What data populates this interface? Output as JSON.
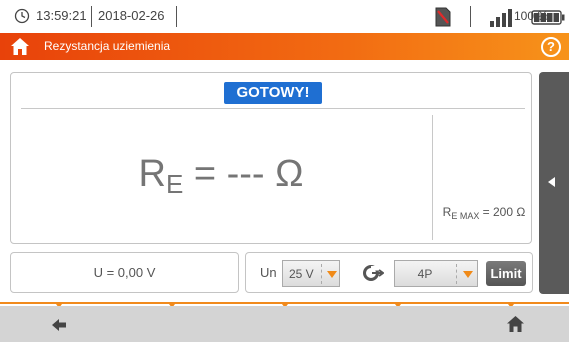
{
  "status_bar": {
    "time": "13:59:21",
    "date": "2018-02-26",
    "battery_percent": "100 %",
    "icons": [
      "clock-icon",
      "sd-card-icon",
      "signal-strength-icon",
      "battery-icon"
    ]
  },
  "title_bar": {
    "title": "Rezystancja uziemienia",
    "home_icon": "home-icon",
    "help_label": "?"
  },
  "measurement": {
    "status_badge": "GOTOWY!",
    "reading_symbol": "R",
    "reading_subscript": "E",
    "reading_value": " = --- Ω",
    "limit_symbol": "R",
    "limit_subscript": "E MAX",
    "limit_value": " = 200 Ω"
  },
  "voltage": {
    "text": "U = 0,00 V"
  },
  "settings": {
    "un_label": "Un",
    "un_value": "25 V",
    "method_icon": "clamp-method-icon",
    "method_value": "4P",
    "limit_button": "Limit"
  },
  "bottom_nav": {
    "back_icon": "back-arrow-icon",
    "home_icon": "home-icon"
  },
  "colors": {
    "accent_orange": "#f26b12",
    "badge_blue": "#1f6fd2",
    "side_tab_gray": "#5a5a5a",
    "bottom_bar_gray": "#d4d4d4"
  }
}
